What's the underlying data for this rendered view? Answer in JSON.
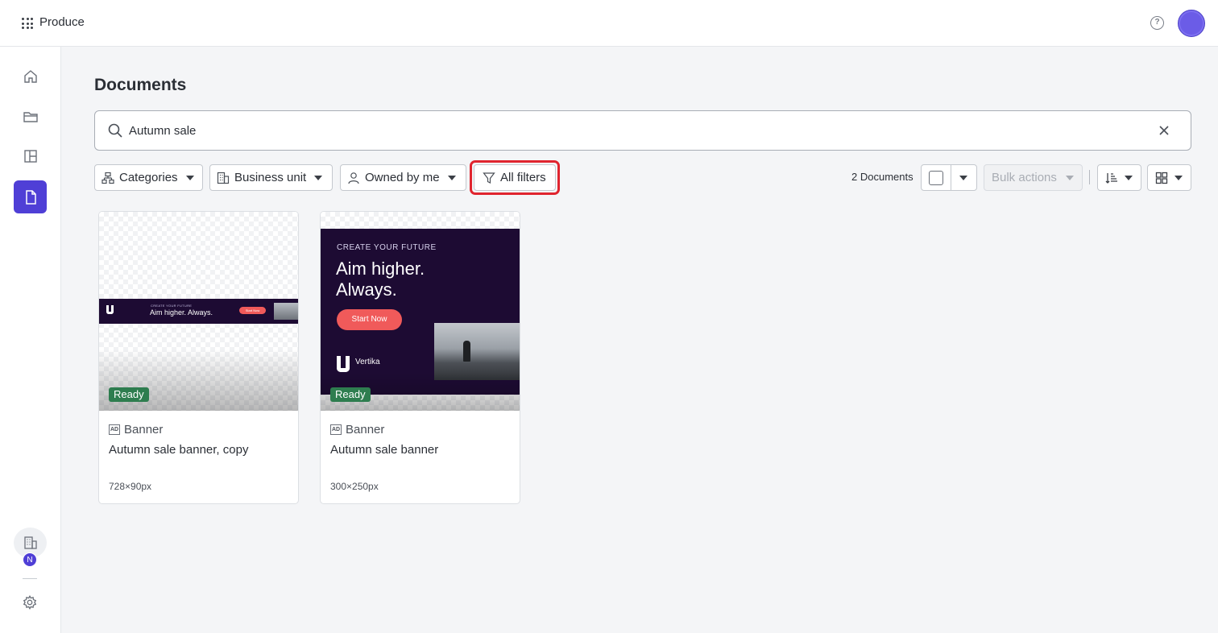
{
  "app": {
    "name": "Produce"
  },
  "icons": {
    "app_menu": "app-grid-icon",
    "help": "help-icon",
    "user": "avatar",
    "sidebar": [
      "home-icon",
      "folder-icon",
      "layout-icon",
      "document-icon"
    ],
    "organization": "building-icon",
    "settings": "gear-icon"
  },
  "sidebar": {
    "active_item": "documents",
    "org_badge": "N"
  },
  "page": {
    "title": "Documents"
  },
  "search": {
    "value": "Autumn sale",
    "placeholder": ""
  },
  "filters": [
    {
      "label": "Categories",
      "icon": "categories-icon"
    },
    {
      "label": "Business unit",
      "icon": "building-icon"
    },
    {
      "label": "Owned by me",
      "icon": "person-icon"
    },
    {
      "label": "All filters",
      "icon": "filter-icon",
      "highlighted": true
    }
  ],
  "toolbar": {
    "count": "2 Documents",
    "bulk_actions": "Bulk actions",
    "bulk_enabled": false,
    "sort_icon": "sort-icon",
    "view_icon": "grid-view-icon"
  },
  "documents": [
    {
      "status": "Ready",
      "type_icon": "ad-icon",
      "type": "Banner",
      "title": "Autumn sale banner, copy",
      "size": "728×90px",
      "preview": {
        "kicker": "CREATE YOUR FUTURE",
        "headline": "Aim higher. Always.",
        "button": "Start Now"
      }
    },
    {
      "status": "Ready",
      "type_icon": "ad-icon",
      "type": "Banner",
      "title": "Autumn sale banner",
      "size": "300×250px",
      "preview": {
        "kicker": "CREATE YOUR FUTURE",
        "headline": "Aim higher.\nAlways.",
        "button": "Start Now",
        "brand": "Vertika"
      }
    }
  ],
  "colors": {
    "accent": "#4f3fd6",
    "ready": "#2e7d4f",
    "highlight": "#e0252f",
    "banner_bg": "#1d0b33",
    "banner_button": "#f05a5a"
  }
}
